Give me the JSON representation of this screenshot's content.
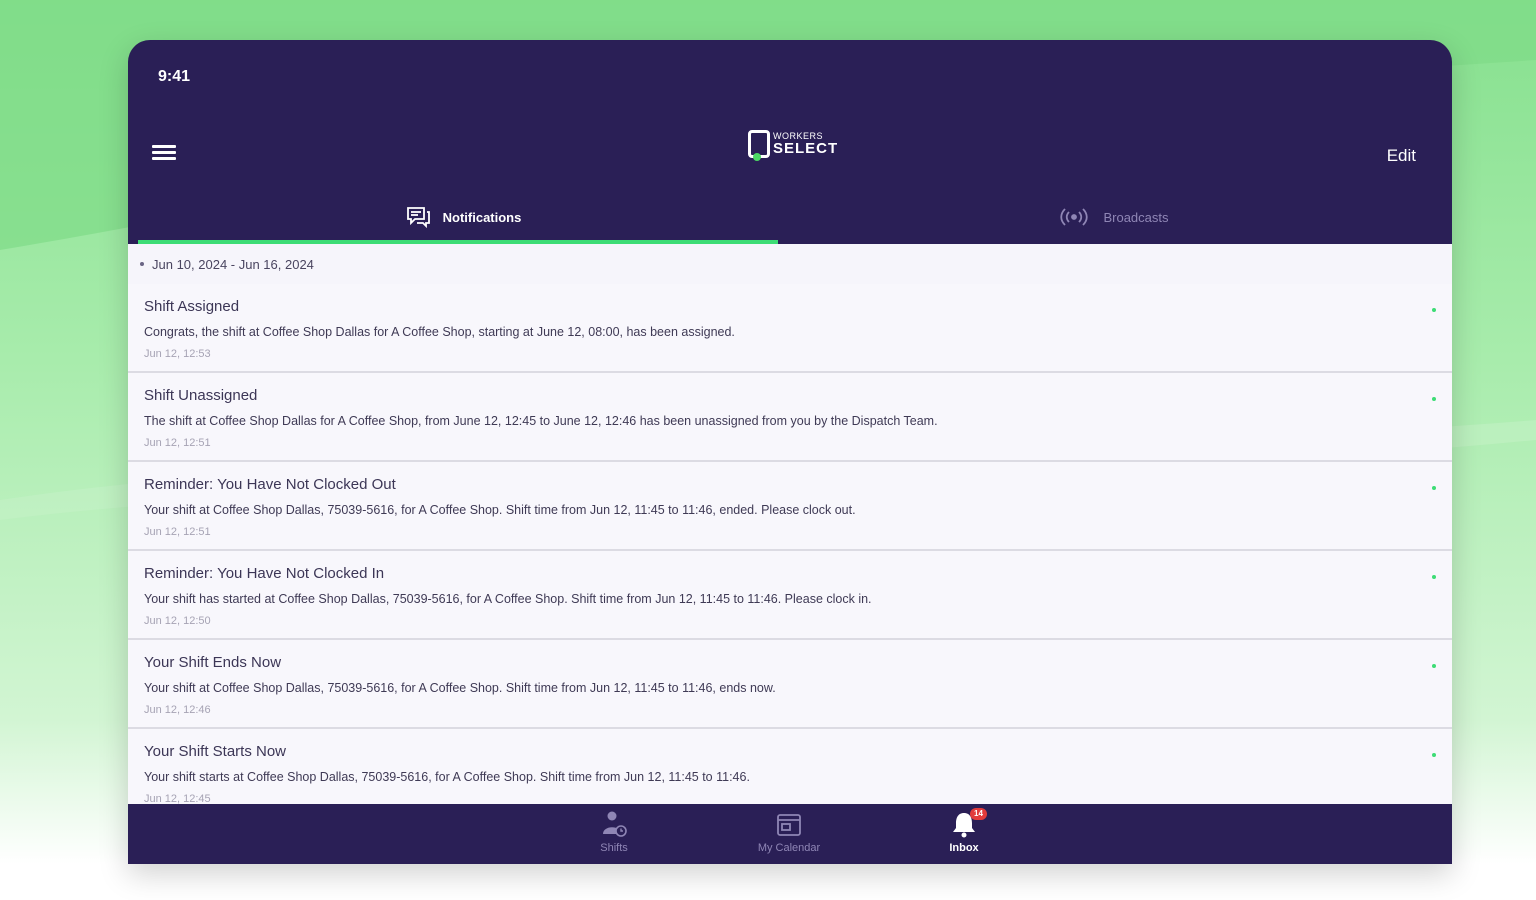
{
  "status_bar": {
    "time": "9:41"
  },
  "header": {
    "logo_top": "WORKERS",
    "logo_bottom": "SELECT",
    "edit_label": "Edit"
  },
  "tabs": [
    {
      "label": "Notifications",
      "icon": "chat-bubble-icon",
      "active": true
    },
    {
      "label": "Broadcasts",
      "icon": "broadcast-icon",
      "active": false
    }
  ],
  "date_range": "Jun 10, 2024 - Jun 16, 2024",
  "notifications": [
    {
      "title": "Shift Assigned",
      "body": "Congrats, the shift at Coffee Shop Dallas for A Coffee Shop, starting at June 12, 08:00, has been assigned.",
      "time": "Jun 12, 12:53"
    },
    {
      "title": "Shift Unassigned",
      "body": "The shift at Coffee Shop Dallas for A Coffee Shop, from June 12, 12:45 to June 12, 12:46 has been unassigned from you by the Dispatch Team.",
      "time": "Jun 12, 12:51"
    },
    {
      "title": "Reminder: You Have Not Clocked Out",
      "body": "Your shift at Coffee Shop Dallas, 75039-5616, for A Coffee Shop. Shift time from Jun 12, 11:45 to 11:46, ended. Please clock out.",
      "time": "Jun 12, 12:51"
    },
    {
      "title": "Reminder: You Have Not Clocked In",
      "body": "Your shift has started at Coffee Shop Dallas, 75039-5616, for A Coffee Shop. Shift time from Jun 12, 11:45 to 11:46. Please clock in.",
      "time": "Jun 12, 12:50"
    },
    {
      "title": "Your Shift Ends Now",
      "body": "Your shift at Coffee Shop Dallas, 75039-5616, for A Coffee Shop. Shift time from Jun 12, 11:45 to 11:46, ends now.",
      "time": "Jun 12, 12:46"
    },
    {
      "title": "Your Shift Starts Now",
      "body": "Your shift starts at Coffee Shop Dallas, 75039-5616, for A Coffee Shop. Shift time from Jun 12, 11:45 to 11:46.",
      "time": "Jun 12, 12:45"
    }
  ],
  "bottom_nav": [
    {
      "label": "Shifts",
      "icon": "person-shift-icon",
      "active": false
    },
    {
      "label": "My Calendar",
      "icon": "calendar-icon",
      "active": false
    },
    {
      "label": "Inbox",
      "icon": "bell-icon",
      "active": true,
      "badge": "14"
    }
  ],
  "colors": {
    "primary": "#2a1f56",
    "accent": "#3ddc75",
    "badge": "#e23b3b"
  }
}
